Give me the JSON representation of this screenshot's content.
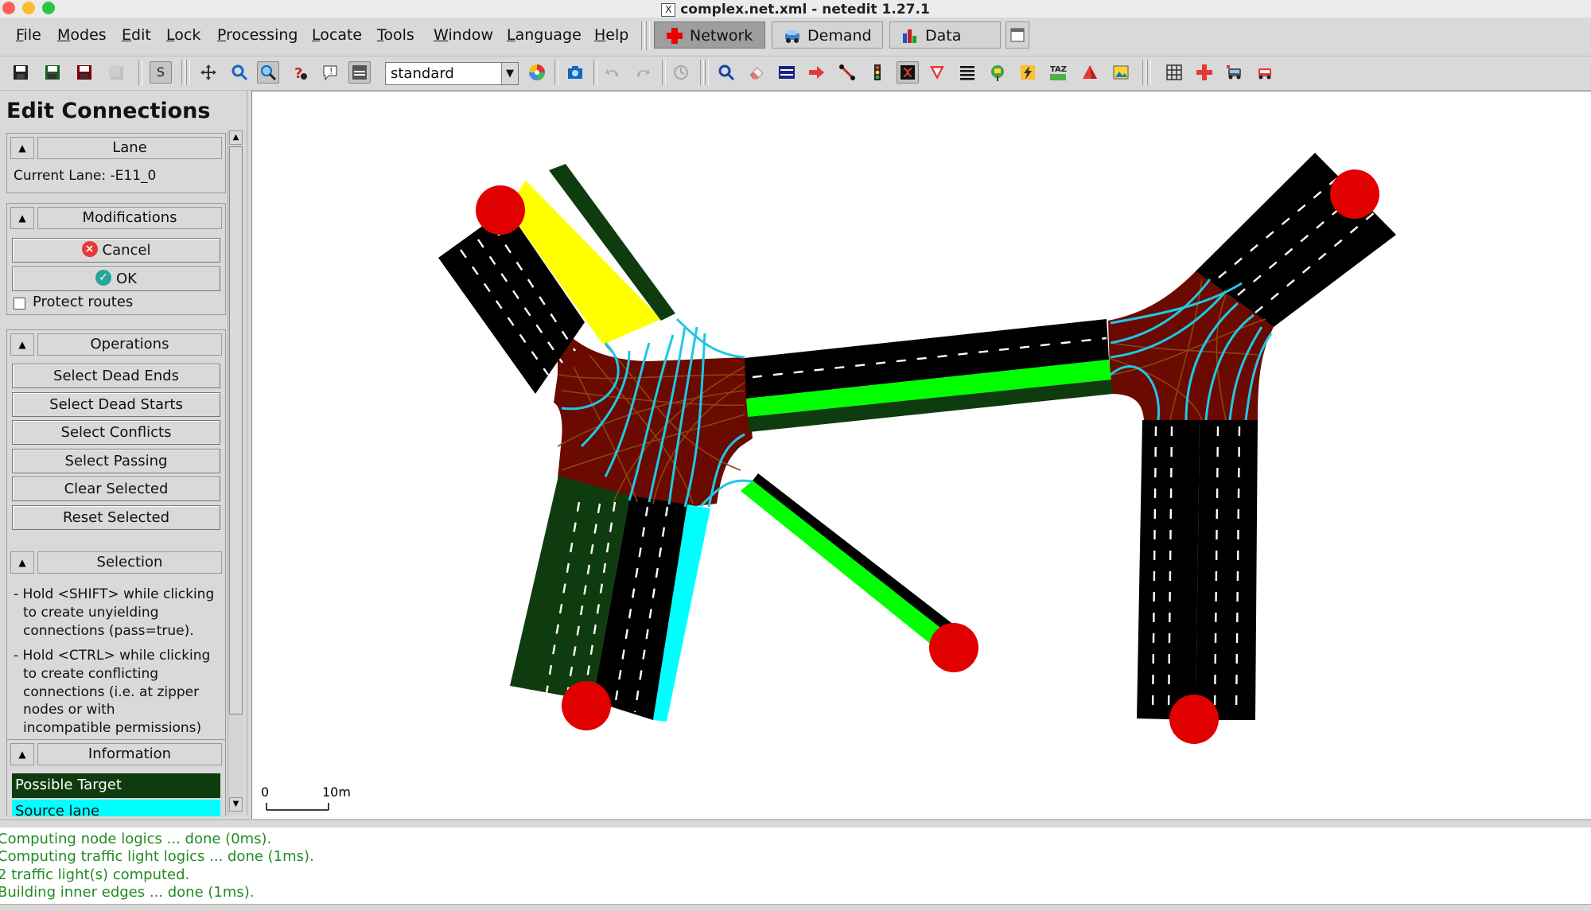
{
  "window": {
    "title": "complex.net.xml - netedit 1.27.1"
  },
  "menubar": {
    "items": [
      "File",
      "Modes",
      "Edit",
      "Lock",
      "Processing",
      "Locate",
      "Tools",
      "Window",
      "Language",
      "Help"
    ],
    "supermodes": {
      "network": "Network",
      "demand": "Demand",
      "data": "Data"
    }
  },
  "toolbar": {
    "mode_letter": "S",
    "color_scheme": "standard",
    "taz_label": "TAZ"
  },
  "panel": {
    "title": "Edit Connections",
    "lane": {
      "header": "Lane",
      "current_lane": "Current Lane: -E11_0"
    },
    "modifications": {
      "header": "Modifications",
      "cancel": "Cancel",
      "ok": "OK",
      "protect_routes": "Protect routes"
    },
    "operations": {
      "header": "Operations",
      "buttons": [
        "Select Dead Ends",
        "Select Dead Starts",
        "Select Conflicts",
        "Select Passing",
        "Clear Selected",
        "Reset Selected"
      ]
    },
    "selection": {
      "header": "Selection",
      "hint_shift": [
        "- Hold <SHIFT> while clicking",
        "to create unyielding",
        "connections (pass=true)."
      ],
      "hint_ctrl": [
        "- Hold <CTRL> while clicking",
        "to create conflicting",
        "connections (i.e. at zipper",
        "nodes or with",
        "incompatible permissions)"
      ]
    },
    "information": {
      "header": "Information",
      "legend": [
        {
          "label": "Possible Target",
          "color": "#0f3c0f"
        },
        {
          "label": "Source lane",
          "color": "#00ffff"
        }
      ]
    }
  },
  "canvas": {
    "scale_start": "0",
    "scale_end": "10m"
  },
  "messages": [
    "Computing node logics ... done (0ms).",
    "Computing traffic light logics ... done (1ms).",
    "2 traffic light(s) computed.",
    "Building inner edges ... done (1ms)."
  ],
  "colors": {
    "junction": "#6b0a00",
    "road": "#000000",
    "possible_target": "#0f3c0f",
    "target_lane": "#00ff00",
    "source_lane": "#00ffff",
    "selected_lane": "#ffff00",
    "node": "#e00000"
  }
}
